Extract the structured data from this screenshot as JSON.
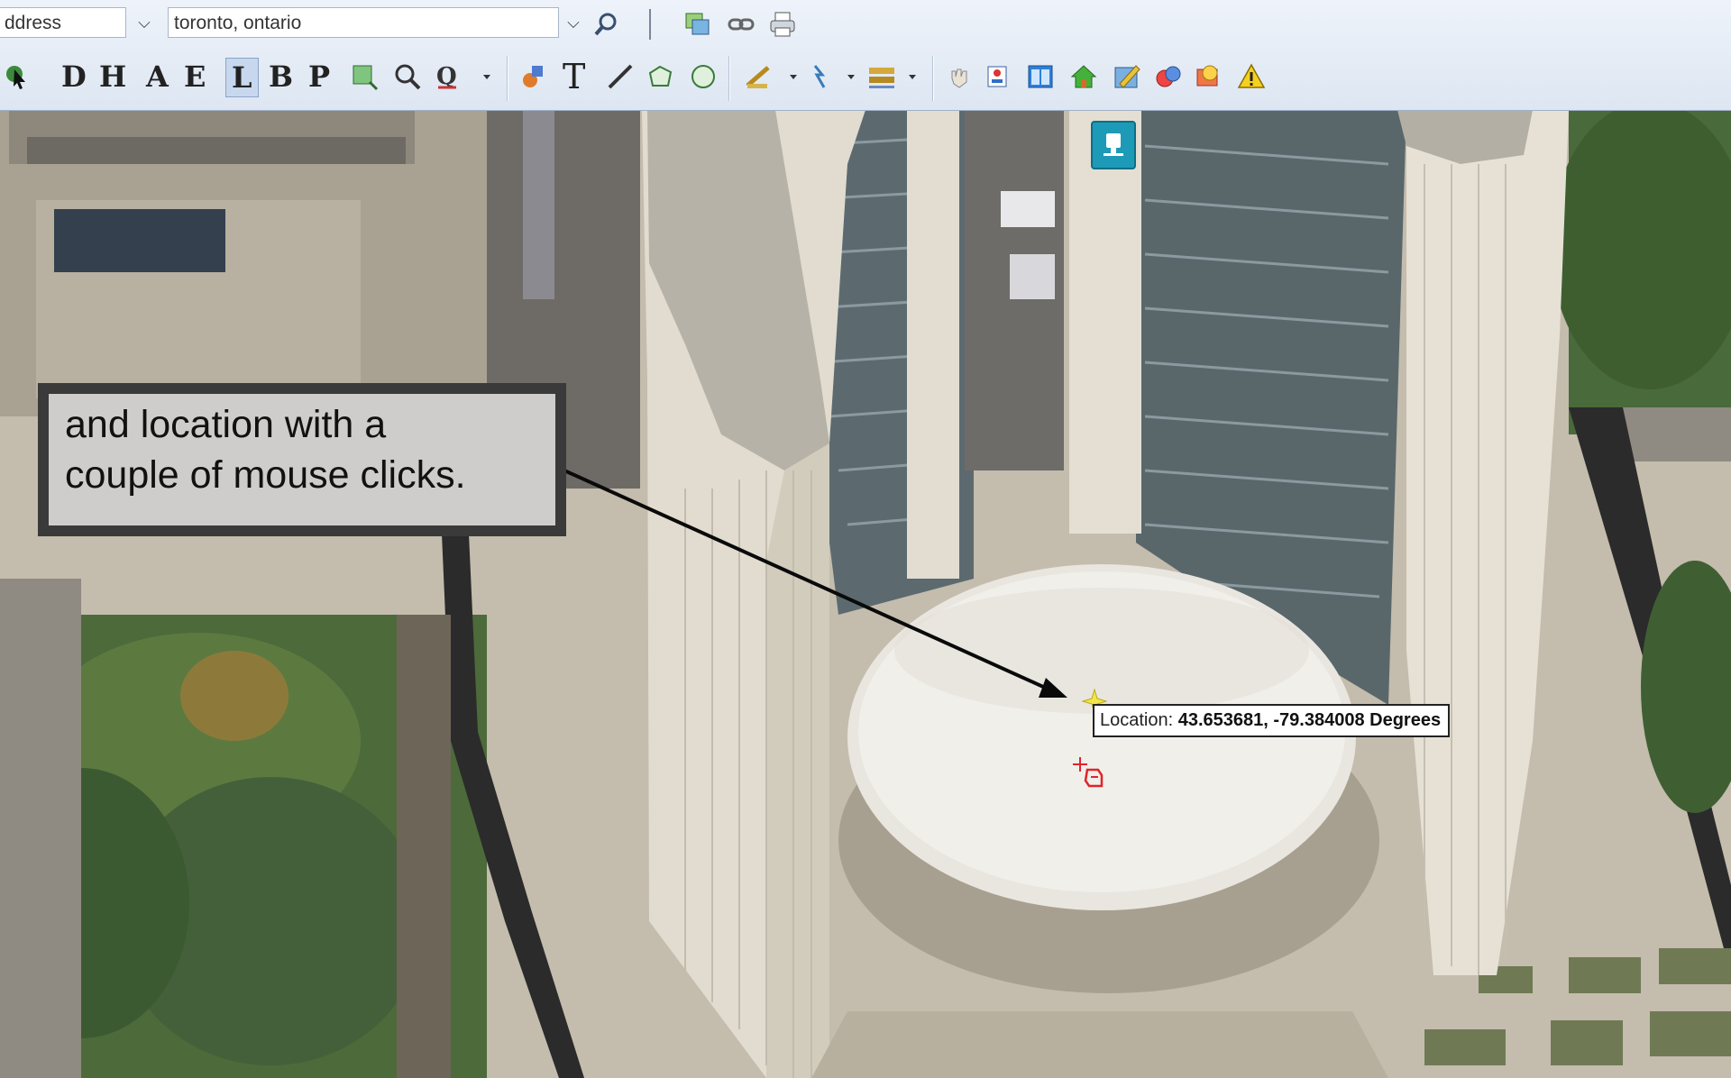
{
  "toolbar": {
    "address_type": "ddress",
    "search_value": "toronto, ontario",
    "tools_row2_letters": [
      "D",
      "H",
      "A",
      "E",
      "L",
      "B",
      "P"
    ],
    "text_tool": "T"
  },
  "callout": {
    "line1": " and location with a",
    "line2": "couple of mouse clicks."
  },
  "tooltip": {
    "label": "Location:",
    "value": "43.653681, -79.384008 Degrees"
  },
  "colors": {
    "accent_teal": "#1d9ab8",
    "marker_yellow": "#f3e44a",
    "cursor_red": "#e0242c"
  }
}
